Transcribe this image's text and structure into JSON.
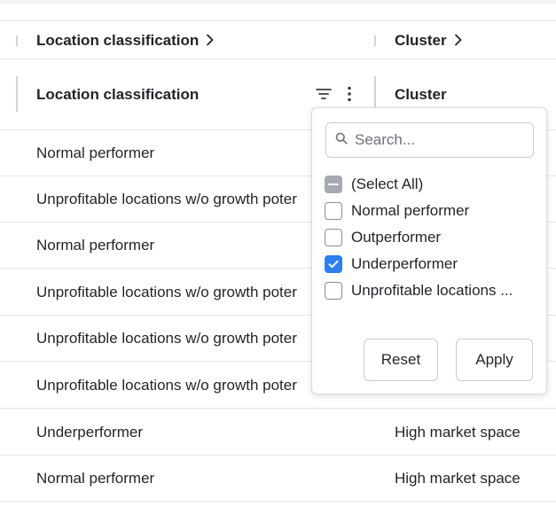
{
  "group_header": {
    "col1": {
      "label": "Location classification",
      "chevron": "chevron-right-icon"
    },
    "col2": {
      "label": "Cluster",
      "chevron": "chevron-right-icon"
    }
  },
  "column_header": {
    "col1": {
      "label": "Location classification",
      "filter_icon": "filter-icon",
      "menu_icon": "more-vertical-icon"
    },
    "col2": {
      "label": "Cluster"
    }
  },
  "rows": [
    {
      "classification": "Normal performer",
      "cluster": ""
    },
    {
      "classification": "Unprofitable locations w/o growth poter",
      "cluster": ""
    },
    {
      "classification": "Normal performer",
      "cluster": ""
    },
    {
      "classification": "Unprofitable locations w/o growth poter",
      "cluster": ""
    },
    {
      "classification": "Unprofitable locations w/o growth poter",
      "cluster": ""
    },
    {
      "classification": "Unprofitable locations w/o growth poter",
      "cluster": ""
    },
    {
      "classification": "Underperformer",
      "cluster": "High market space"
    },
    {
      "classification": "Normal performer",
      "cluster": "High market space"
    }
  ],
  "filter_popup": {
    "search_placeholder": "Search...",
    "search_icon": "search-icon",
    "options": [
      {
        "label": "(Select All)",
        "state": "indeterminate"
      },
      {
        "label": "Normal performer",
        "state": "unchecked"
      },
      {
        "label": "Outperformer",
        "state": "unchecked"
      },
      {
        "label": "Underperformer",
        "state": "checked"
      },
      {
        "label": "Unprofitable locations ...",
        "state": "unchecked"
      }
    ],
    "reset_label": "Reset",
    "apply_label": "Apply"
  },
  "colors": {
    "accent": "#2b7ff0",
    "border": "#e3e5e8",
    "indeterminate": "#a5aab0"
  }
}
